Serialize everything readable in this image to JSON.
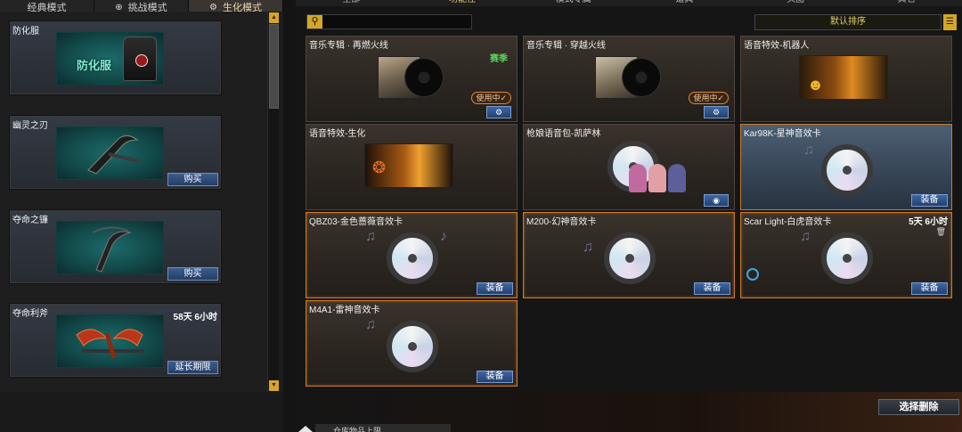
{
  "mode_tabs": [
    {
      "label": "经典模式",
      "icon": ""
    },
    {
      "label": "挑战模式",
      "icon": "settings-icon"
    },
    {
      "label": "生化模式",
      "icon": "gear-icon"
    }
  ],
  "left_items": [
    {
      "name": "防化服",
      "duration": "",
      "button": "",
      "overlay_text": "防化服"
    },
    {
      "name": "幽灵之刃",
      "duration": "",
      "button": "购买"
    },
    {
      "name": "夺命之镰",
      "duration": "",
      "button": "购买"
    },
    {
      "name": "夺命利斧",
      "duration": "58天 6小时",
      "button": "延长期限"
    }
  ],
  "top_tabs": [
    "全部",
    "功能性",
    "模式专属",
    "道具",
    "头图",
    "其它"
  ],
  "search": {
    "placeholder": ""
  },
  "sort": {
    "label": "默认排序"
  },
  "items": [
    {
      "name": "音乐专辑 · 再燃火线",
      "tag": "赛季",
      "status": "使用中✓",
      "action": "⚙"
    },
    {
      "name": "音乐专辑 · 穿越火线",
      "status": "使用中✓",
      "action": "⚙"
    },
    {
      "name": "语音特效-机器人"
    },
    {
      "name": "语音特效-生化"
    },
    {
      "name": "枪娘语音包-凯萨林",
      "action": "◉"
    },
    {
      "name": "Kar98K-星神音效卡",
      "action": "装备"
    },
    {
      "name": "QBZ03-金色蔷薇音效卡",
      "action": "装备"
    },
    {
      "name": "M200-幻神音效卡",
      "action": "装备"
    },
    {
      "name": "Scar Light-白虎音效卡",
      "duration": "5天 6小时",
      "action": "装备"
    },
    {
      "name": "M4A1-雷神音效卡",
      "action": "装备"
    }
  ],
  "bottom": {
    "delete_label": "选择删除",
    "tab_label": "仓库物品上限"
  },
  "colors": {
    "accent_gold": "#d3a728",
    "button_blue": "#2f5288",
    "card_gold_border": "#c97a2a",
    "tag_green": "#5ed25e"
  }
}
